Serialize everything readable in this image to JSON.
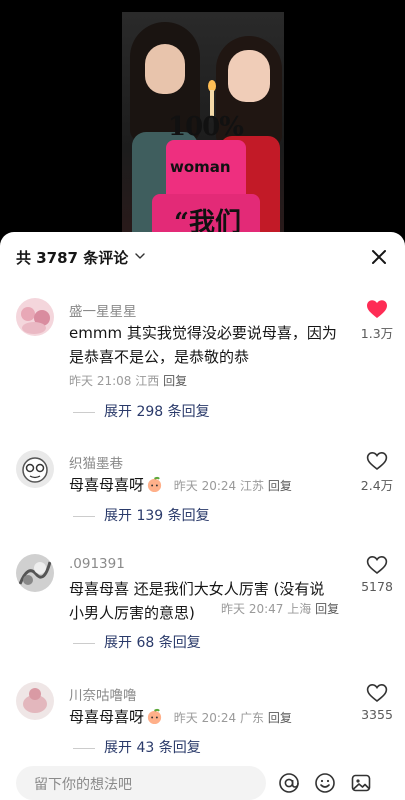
{
  "video": {
    "topper_text": "100%",
    "cake_text_1": "woman",
    "cake_text_2": "“我们"
  },
  "comments_header": {
    "title": "共 3787 条评论",
    "chevron_icon": "chevron-down-icon",
    "close_icon": "close-icon"
  },
  "comments": [
    {
      "username": "盛一星星星",
      "text": "emmm 其实我觉得没必要说母喜，因为是恭喜不是公，是恭敬的恭",
      "time": "昨天 21:08",
      "location": "江西",
      "reply_label": "回复",
      "likes": "1.3万",
      "liked": true,
      "expand": "展开 298 条回复"
    },
    {
      "username": "织猫墨巷",
      "text": "母喜母喜呀",
      "time": "昨天 20:24",
      "location": "江苏",
      "reply_label": "回复",
      "likes": "2.4万",
      "liked": false,
      "expand": "展开 139 条回复"
    },
    {
      "username": ".091391",
      "text": "母喜母喜 还是我们大女人厉害 (没有说小男人厉害的意思)",
      "time": "昨天 20:47",
      "location": "上海",
      "reply_label": "回复",
      "likes": "5178",
      "liked": false,
      "expand": "展开 68 条回复"
    },
    {
      "username": "川奈咕噜噜",
      "text": "母喜母喜呀",
      "time": "昨天 20:24",
      "location": "广东",
      "reply_label": "回复",
      "likes": "3355",
      "liked": false,
      "expand": "展开 43 条回复"
    }
  ],
  "input": {
    "placeholder": "留下你的想法吧",
    "icons": [
      "at-icon",
      "emoji-icon",
      "image-icon"
    ]
  },
  "colors": {
    "like_active": "#fe2c55",
    "sheet_bg": "#ffffff",
    "expand_text": "#2a3a6a"
  }
}
